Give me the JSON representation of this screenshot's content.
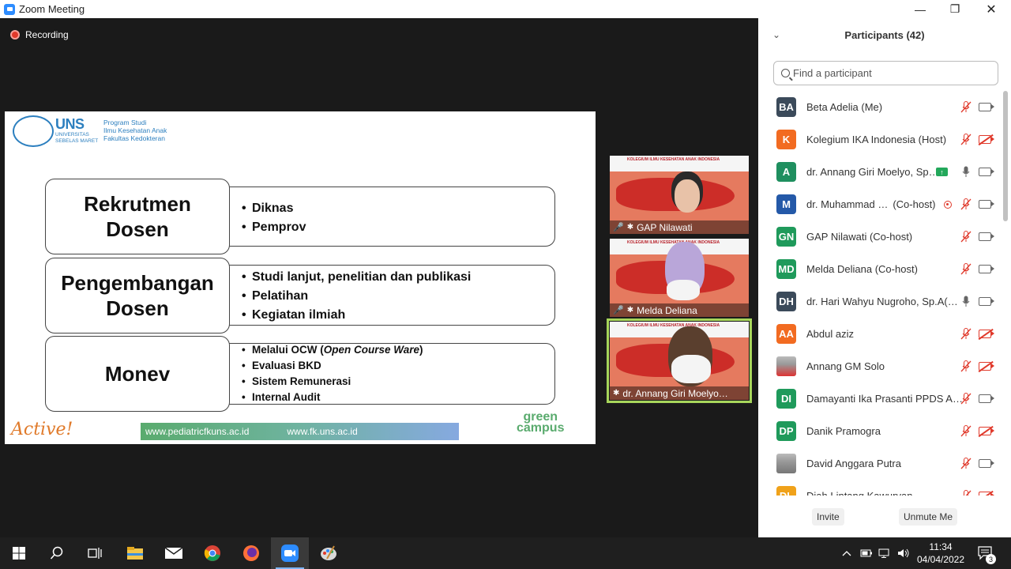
{
  "window": {
    "title": "Zoom Meeting"
  },
  "meeting": {
    "recording_label": "Recording",
    "slide": {
      "header": {
        "uns": "UNS",
        "uns_sub": "UNIVERSITAS SEBELAS MARET",
        "program": [
          "Program Studi",
          "Ilmu Kesehatan Anak",
          "Fakultas Kedokteran"
        ]
      },
      "rows": [
        {
          "title": [
            "Rekrutmen",
            "Dosen"
          ],
          "bullets": [
            "Diknas",
            "Pemprov"
          ]
        },
        {
          "title": [
            "Pengembangan",
            "Dosen"
          ],
          "bullets": [
            "Studi lanjut, penelitian dan publikasi",
            "Pelatihan",
            "Kegiatan ilmiah"
          ]
        },
        {
          "title": [
            "Monev"
          ],
          "bullets_small": {
            "ocw_prefix": "Melalui OCW (",
            "ocw_italic": "Open Course Ware",
            "ocw_suffix": ")",
            "rest": [
              "Evaluasi BKD",
              "Sistem Remunerasi",
              "Internal Audit"
            ]
          }
        }
      ],
      "footer": {
        "active": "Active!",
        "url1": "www.pediatricfkuns.ac.id",
        "url2": "www.fk.uns.ac.id",
        "green": "green",
        "campus": "campus"
      }
    },
    "videos": [
      {
        "name": "GAP Nilawati",
        "banner": "KOLEGIUM ILMU KESEHATAN ANAK INDONESIA"
      },
      {
        "name": "Melda Deliana",
        "banner": "KOLEGIUM ILMU KESEHATAN ANAK INDONESIA"
      },
      {
        "name": "dr. Annang Giri Moelyo…",
        "banner": "KOLEGIUM ILMU KESEHATAN ANAK INDONESIA"
      }
    ]
  },
  "participants": {
    "title": "Participants (42)",
    "search_placeholder": "Find a participant",
    "list": [
      {
        "initials": "BA",
        "color": "#3b4a5a",
        "name": "Beta Adelia (Me)",
        "mic": "muted",
        "cam": "on"
      },
      {
        "initials": "K",
        "color": "#f26b21",
        "name": "Kolegium IKA Indonesia (Host)",
        "mic": "muted",
        "cam": "off"
      },
      {
        "initials": "A",
        "color": "#1f8f5f",
        "name": "dr. Annang Giri Moelyo, Sp…",
        "mic": "on",
        "cam": "on",
        "share": true
      },
      {
        "initials": "M",
        "color": "#2459a8",
        "name": "dr. Muhammad …",
        "role": "(Co-host)",
        "mic": "muted",
        "cam": "on",
        "rec": true
      },
      {
        "initials": "GN",
        "color": "#1f9a5b",
        "name": "GAP Nilawati (Co-host)",
        "mic": "muted",
        "cam": "on"
      },
      {
        "initials": "MD",
        "color": "#1f9a5b",
        "name": "Melda Deliana (Co-host)",
        "mic": "muted",
        "cam": "on"
      },
      {
        "initials": "DH",
        "color": "#3b4a5a",
        "name": "dr. Hari Wahyu Nugroho, Sp.A(…",
        "mic": "on",
        "cam": "on"
      },
      {
        "initials": "AA",
        "color": "#f26b21",
        "name": "Abdul aziz",
        "mic": "muted",
        "cam": "off"
      },
      {
        "initials": "",
        "color": "#d33",
        "name": "Annang GM Solo",
        "mic": "muted",
        "cam": "off",
        "photo": true
      },
      {
        "initials": "DI",
        "color": "#1f9a5b",
        "name": "Damayanti Ika Prasanti PPDS A…",
        "mic": "muted",
        "cam": "on"
      },
      {
        "initials": "DP",
        "color": "#1f9a5b",
        "name": "Danik Pramogra",
        "mic": "muted",
        "cam": "off"
      },
      {
        "initials": "",
        "color": "#777",
        "name": "David Anggara Putra",
        "mic": "muted",
        "cam": "on",
        "photo": true
      },
      {
        "initials": "DL",
        "color": "#f0a21a",
        "name": "Diah Lintang Kawuryan",
        "mic": "muted",
        "cam": "off"
      }
    ],
    "invite_label": "Invite",
    "unmute_label": "Unmute Me"
  },
  "taskbar": {
    "time": "11:34",
    "date": "04/04/2022",
    "notifications": "3"
  }
}
